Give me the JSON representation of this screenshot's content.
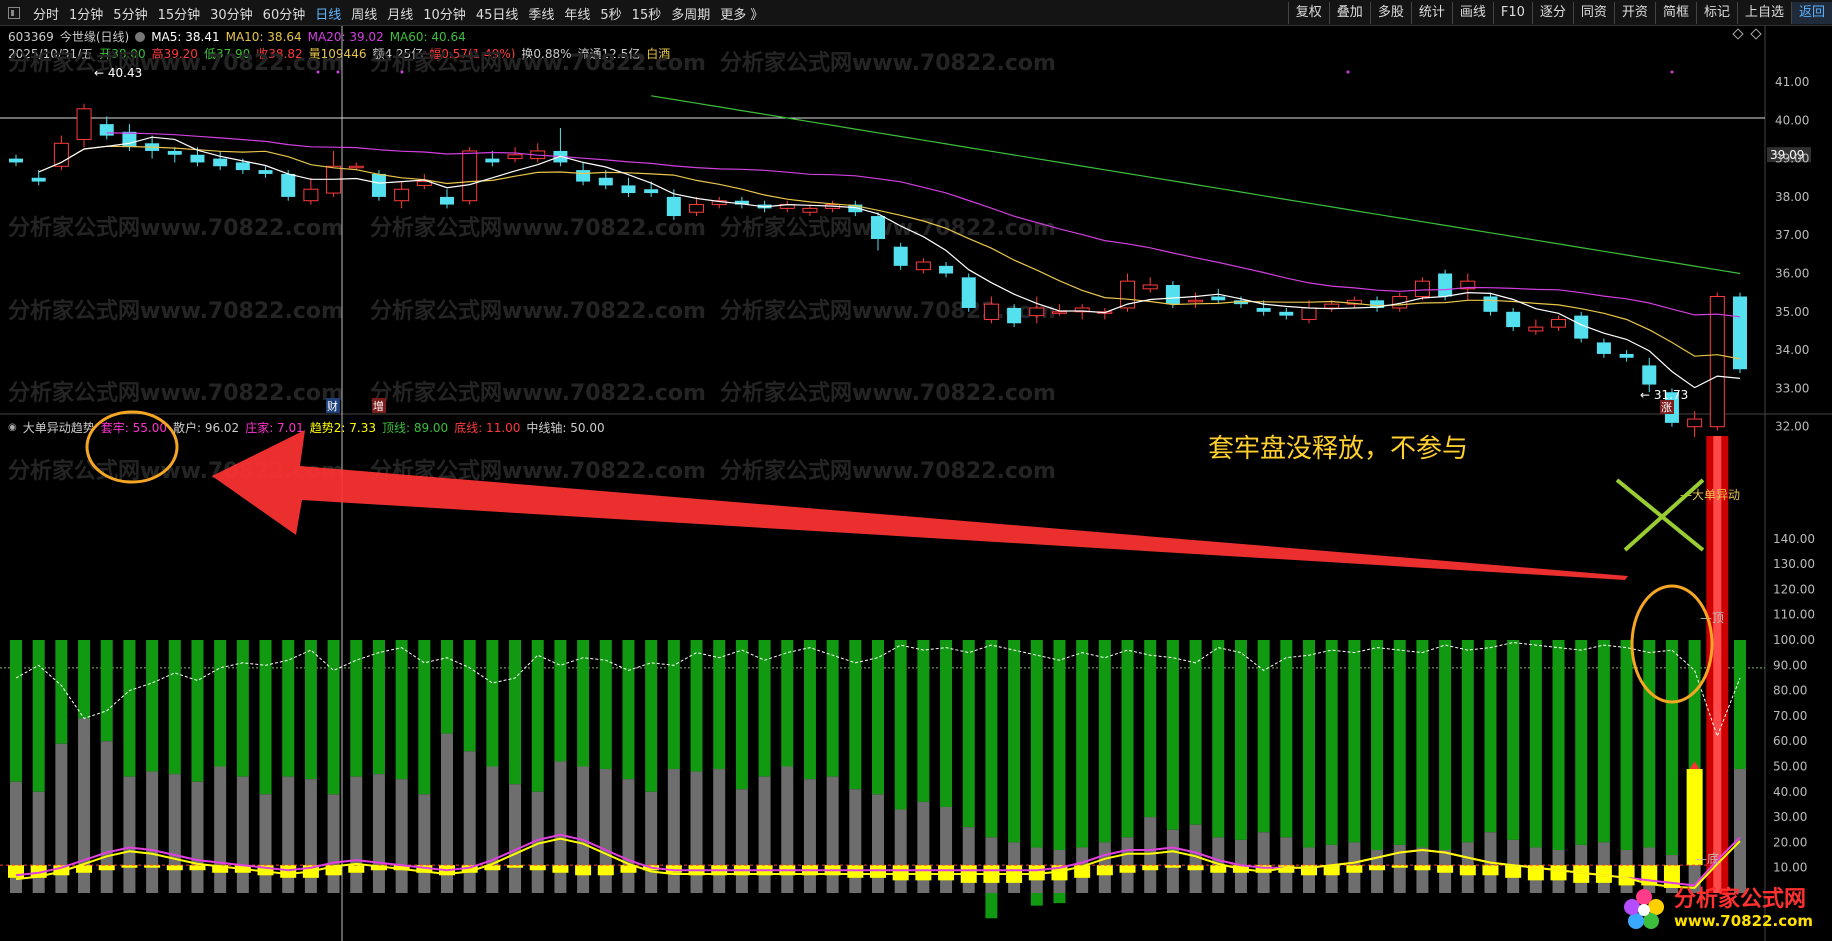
{
  "toolbar": {
    "periods": [
      "分时",
      "1分钟",
      "5分钟",
      "15分钟",
      "30分钟",
      "60分钟",
      "日线",
      "周线",
      "月线",
      "10分钟",
      "45日线",
      "季线",
      "年线",
      "5秒",
      "15秒",
      "多周期",
      "更多 》"
    ],
    "active_period": "日线",
    "right_buttons": [
      "复权",
      "叠加",
      "多股",
      "统计",
      "画线",
      "F10",
      "逐分",
      "同资",
      "开资",
      "简框",
      "标记",
      "上自选",
      "返回"
    ]
  },
  "stock": {
    "code": "603369",
    "name": "今世缘(日线)"
  },
  "ma": {
    "ma5": "MA5: 38.41",
    "ma10": "MA10: 38.64",
    "ma20": "MA20: 39.02",
    "ma60": "MA60: 40.64",
    "colors": {
      "ma5": "#ffffff",
      "ma10": "#e8c54a",
      "ma20": "#d23fe0",
      "ma60": "#3cbf3c"
    }
  },
  "quote": {
    "date": "2025/10/31/五",
    "open": "开38.00",
    "high": "高39.20",
    "low": "低37.90",
    "close": "收38.82",
    "vol": "量109446",
    "amount": "额4.25亿",
    "range": "幅0.57(1.49%)",
    "turnover": "换0.88%",
    "float": "流通12.5亿",
    "tag": "白酒"
  },
  "indicator": {
    "name": "大单异动趋势",
    "tl": "套牢: 55.00",
    "sh": "散户: 96.02",
    "zj": "庄家: 7.01",
    "trend2": "趋势2: 7.33",
    "top": "顶线: 89.00",
    "bottom": "底线: 11.00",
    "mid": "中线轴: 50.00",
    "label_big": "大单异动",
    "label_top": "顶",
    "label_bottom": "底"
  },
  "price_axis": [
    "41.00",
    "40.00",
    "39.09",
    "39.00",
    "38.00",
    "37.00",
    "36.00",
    "35.00",
    "34.00",
    "33.00",
    "32.00"
  ],
  "ind_axis": [
    "140.00",
    "130.00",
    "120.00",
    "110.00",
    "100.00",
    "90.00",
    "80.00",
    "70.00",
    "60.00",
    "50.00",
    "40.00",
    "30.00",
    "20.00",
    "10.00"
  ],
  "annotations": {
    "high": "40.43",
    "low": "31.73",
    "cai": "财",
    "zeng": "增",
    "zhang": "涨",
    "current": "39.09"
  },
  "note": "套牢盘没释放，不参与",
  "watermark": "分析家公式网www.70822.com",
  "logo": {
    "line1": "分析家公式网",
    "line2": "www.70822.com"
  },
  "colors": {
    "up": "#ff3b3b",
    "down": "#55e0f0",
    "green_bar": "#119911",
    "grey_bar": "#6e6e6e",
    "yellow": "#ffff00",
    "note": "#ffd02e"
  }
}
